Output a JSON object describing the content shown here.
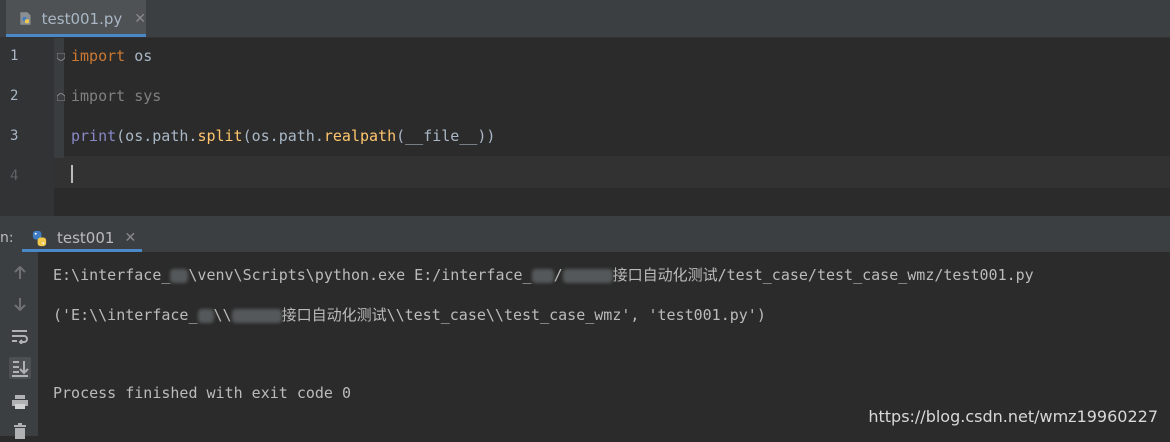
{
  "editor": {
    "tab": {
      "label": "test001.py",
      "close": "✕"
    },
    "line_numbers": [
      "1",
      "2",
      "3",
      "4"
    ],
    "code": {
      "l1_kw": "import",
      "l1_rest": " os",
      "l2_kw": "import",
      "l2_rest": " sys",
      "l3_fn": "print",
      "l3_a": "(os.path.",
      "l3_split": "split",
      "l3_b": "(os.path.",
      "l3_realpath": "realpath",
      "l3_c": "(__file__))"
    }
  },
  "run": {
    "prefix": "n:",
    "tab": {
      "label": "test001",
      "close": "✕"
    },
    "console": {
      "line1_a": "E:\\interface_",
      "line1_b": "\\venv\\Scripts\\python.exe E:/interface_",
      "line1_c": "/",
      "line1_d": "接口自动化测试/test_case/test_case_wmz/test001.py",
      "line2_a": "('E:\\\\interface_",
      "line2_b": "\\\\",
      "line2_c": "接口自动化测试\\\\test_case\\\\test_case_wmz', 'test001.py')",
      "line3": "Process finished with exit code 0"
    }
  },
  "watermark": "https://blog.csdn.net/wmz19960227",
  "colors": {
    "accent": "#4a88c7",
    "background": "#2b2b2b",
    "keyword": "#cc7832",
    "function": "#ffc66d",
    "builtin": "#8888c6"
  },
  "icons": [
    "python-file-icon",
    "close-icon",
    "up-arrow-icon",
    "down-arrow-icon",
    "soft-wrap-icon",
    "scroll-to-end-icon",
    "print-icon",
    "trash-icon"
  ]
}
